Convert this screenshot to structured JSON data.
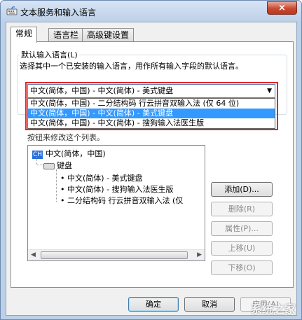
{
  "window": {
    "title": "文本服务和输入语言",
    "close_label": "×"
  },
  "tabs": [
    {
      "label": "常规"
    },
    {
      "label": "语言栏"
    },
    {
      "label": "高级键设置"
    }
  ],
  "default_lang": {
    "label": "默认输入语言(L)",
    "description": "选择其中一个已安装的输入语言，用作所有输入字段的默认语言。",
    "selected": "中文(简体，中国) - 中文(简体) - 美式键盘",
    "options": [
      "中文(简体，中国) - 二分结构码 行云拼音双输入法 (仅 64 位)",
      "中文(简体，中国) - 中文(简体) - 美式键盘",
      "中文(简体，中国) - 中文(简体) - 搜狗输入法医生版"
    ]
  },
  "installed": {
    "partial_text": "按钮来修改这个列表。",
    "lang_badge": "CH",
    "lang_name": "中文(简体，中国)",
    "keyboard_label": "键盘",
    "items": [
      "中文(简体) - 美式键盘",
      "中文(简体) - 搜狗输入法医生版",
      "二分结构码 行云拼音双输入法 (仅"
    ]
  },
  "buttons": {
    "add": "添加(D)...",
    "remove": "删除(R)",
    "properties": "属性(P)...",
    "move_up": "上移(U)",
    "move_down": "下移(O)",
    "ok": "确定",
    "cancel": "取消",
    "apply": "应用(A)"
  },
  "watermark": "系统之家"
}
